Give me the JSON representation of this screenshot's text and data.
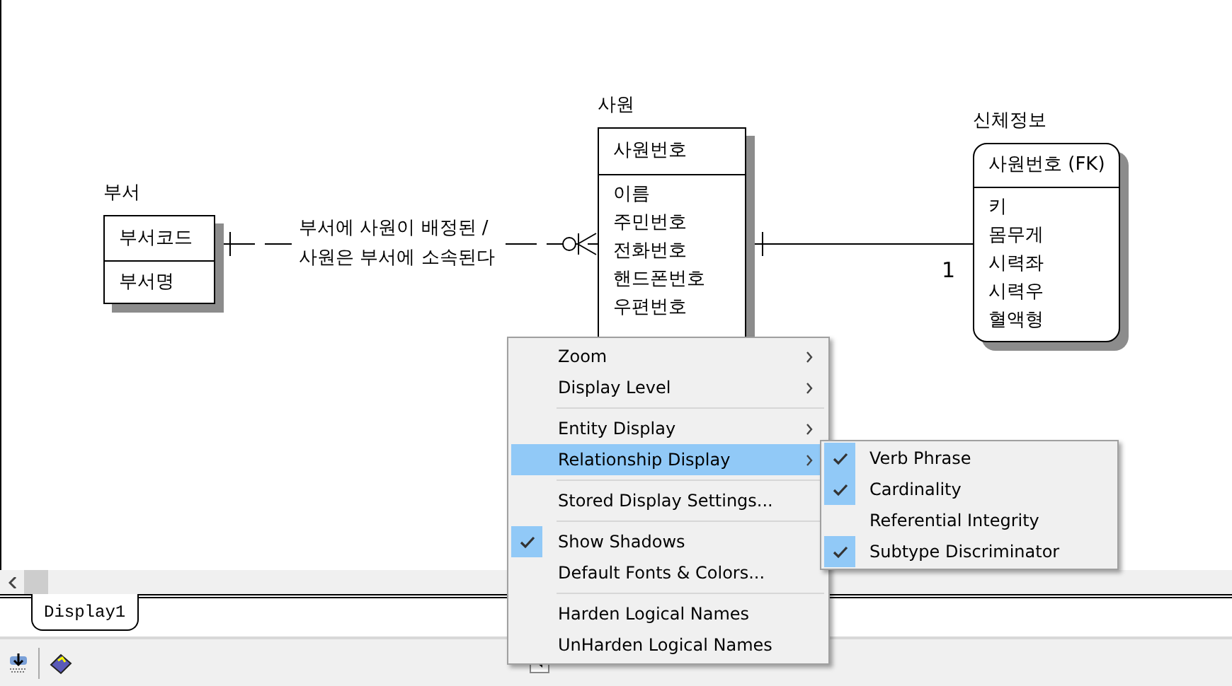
{
  "entities": [
    {
      "name": "부서",
      "kind": "independent",
      "keys": [
        "부서코드"
      ],
      "attributes": [
        "부서명"
      ]
    },
    {
      "name": "사원",
      "kind": "independent",
      "keys": [
        "사원번호"
      ],
      "attributes": [
        "이름",
        "주민번호",
        "전화번호",
        "핸드폰번호",
        "우편번호"
      ]
    },
    {
      "name": "신체정보",
      "kind": "dependent",
      "keys": [
        "사원번호 (FK)"
      ],
      "attributes": [
        "키",
        "몸무게",
        "시력좌",
        "시력우",
        "혈액형"
      ]
    }
  ],
  "relationships": [
    {
      "kind": "zero-or-more",
      "verb_phrase": [
        "부서에 사원이 배정된 /",
        "사원은 부서에 소속된다"
      ]
    },
    {
      "kind": "exactly-one",
      "cardinality": "1"
    }
  ],
  "context_menu": [
    {
      "kind": "item",
      "label": "Zoom",
      "submenu": true,
      "checked": false,
      "selected": false
    },
    {
      "kind": "item",
      "label": "Display Level",
      "submenu": true,
      "checked": false,
      "selected": false
    },
    {
      "kind": "separator"
    },
    {
      "kind": "item",
      "label": "Entity Display",
      "submenu": true,
      "checked": false,
      "selected": false
    },
    {
      "kind": "item",
      "label": "Relationship Display",
      "submenu": true,
      "checked": false,
      "selected": true
    },
    {
      "kind": "separator"
    },
    {
      "kind": "item",
      "label": "Stored Display Settings...",
      "submenu": false,
      "checked": false,
      "selected": false
    },
    {
      "kind": "separator"
    },
    {
      "kind": "item",
      "label": "Show Shadows",
      "submenu": false,
      "checked": true,
      "selected": false
    },
    {
      "kind": "item",
      "label": "Default Fonts & Colors...",
      "submenu": false,
      "checked": false,
      "selected": false
    },
    {
      "kind": "separator"
    },
    {
      "kind": "item",
      "label": "Harden Logical Names",
      "submenu": false,
      "checked": false,
      "selected": false
    },
    {
      "kind": "item",
      "label": "UnHarden Logical Names",
      "submenu": false,
      "checked": false,
      "selected": false
    }
  ],
  "submenu": [
    {
      "label": "Verb Phrase",
      "checked": true
    },
    {
      "label": "Cardinality",
      "checked": true
    },
    {
      "label": "Referential Integrity",
      "checked": false
    },
    {
      "label": "Subtype Discriminator",
      "checked": true
    }
  ],
  "tabs": [
    {
      "label": "Display1",
      "selected": true
    }
  ]
}
